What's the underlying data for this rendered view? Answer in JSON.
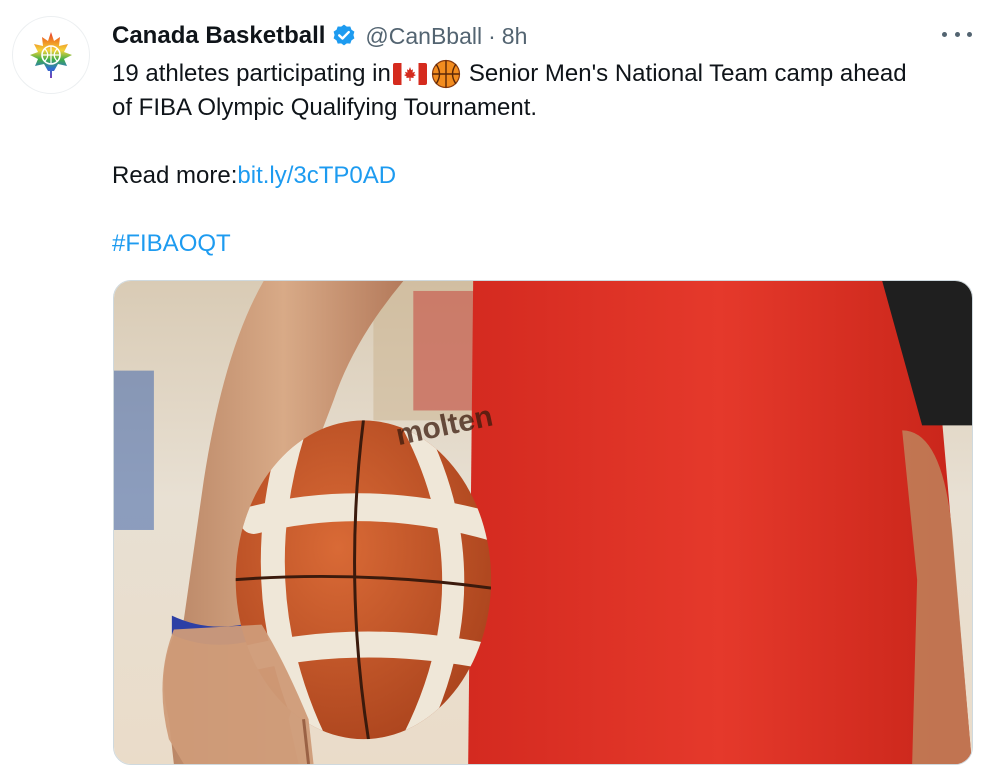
{
  "tweet": {
    "author": {
      "display_name": "Canada Basketball",
      "handle": "@CanBball",
      "verified": true,
      "avatar_icon": "rainbow-maple-leaf-basketball-logo"
    },
    "separator": "·",
    "timestamp": "8h",
    "more_icon": "ellipsis-icon",
    "text": {
      "line1_before": "19 athletes participating in ",
      "line1_after": " Senior Men's National Team camp ahead",
      "line2": "of FIBA Olympic Qualifying Tournament.",
      "read_more_label": "Read more: ",
      "read_more_link": "bit.ly/3cTP0AD",
      "hashtag": "#FIBAOQT"
    },
    "emojis": [
      "canada-flag-icon",
      "basketball-icon"
    ],
    "media": {
      "type": "photo",
      "subject": "player in red jersey holding a molten basketball",
      "ball_brand": "molten"
    },
    "colors": {
      "link": "#1d9bf0",
      "text": "#0f1419",
      "secondary": "#536471",
      "verified": "#1d9bf0"
    }
  }
}
